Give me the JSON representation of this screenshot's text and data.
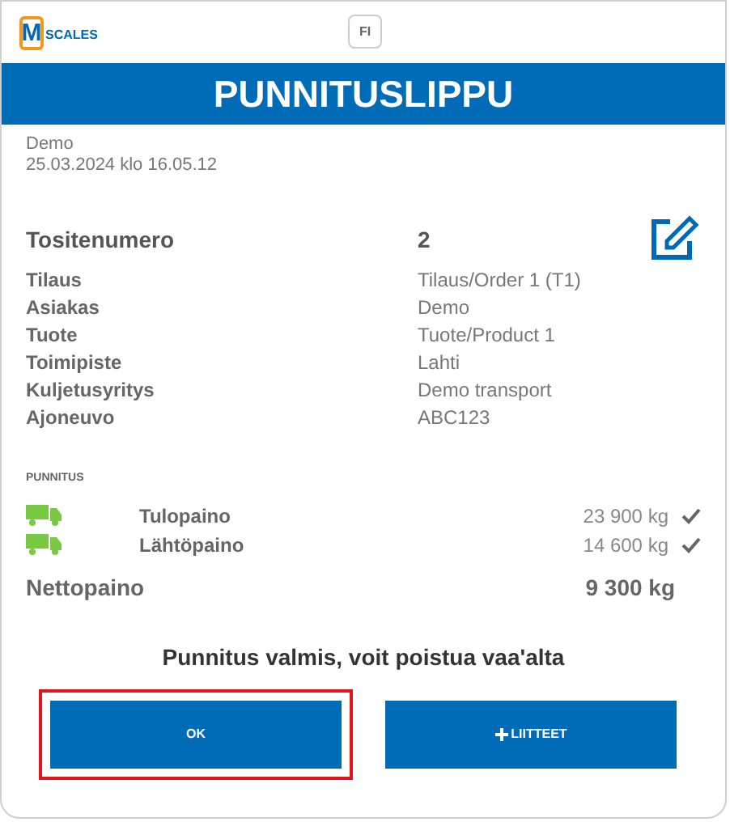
{
  "logo": {
    "mark": "M",
    "text": "SCALES"
  },
  "language": "FI",
  "title": "PUNNITUSLIPPU",
  "customer": "Demo",
  "datetime": "25.03.2024 klo 16.05.12",
  "receipt": {
    "label": "Tositenumero",
    "value": "2"
  },
  "details": [
    {
      "label": "Tilaus",
      "value": "Tilaus/Order 1 (T1)"
    },
    {
      "label": "Asiakas",
      "value": "Demo"
    },
    {
      "label": "Tuote",
      "value": "Tuote/Product 1"
    },
    {
      "label": "Toimipiste",
      "value": "Lahti"
    },
    {
      "label": "Kuljetusyritys",
      "value": "Demo transport"
    },
    {
      "label": "Ajoneuvo",
      "value": "ABC123"
    }
  ],
  "weighing": {
    "heading": "PUNNITUS",
    "rows": [
      {
        "label": "Tulopaino",
        "value": "23 900 kg",
        "confirmed": true
      },
      {
        "label": "Lähtöpaino",
        "value": "14 600 kg",
        "confirmed": true
      }
    ],
    "net": {
      "label": "Nettopaino",
      "value": "9 300 kg"
    }
  },
  "message": "Punnitus valmis, voit poistua vaa'alta",
  "buttons": [
    {
      "label": "OK",
      "kind": "plain",
      "highlighted": true
    },
    {
      "label": "LIITTEET",
      "kind": "add",
      "highlighted": false
    }
  ]
}
